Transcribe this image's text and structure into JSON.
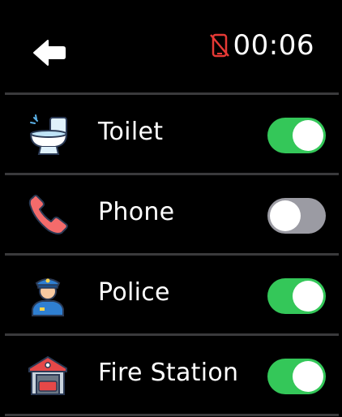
{
  "header": {
    "back_icon": "arrow-left-icon",
    "status_icon": "phone-disabled-icon",
    "time": "00:06"
  },
  "settings": [
    {
      "label": "Toilet",
      "icon": "toilet-icon",
      "enabled": true
    },
    {
      "label": "Phone",
      "icon": "phone-icon",
      "enabled": false
    },
    {
      "label": "Police",
      "icon": "police-officer-icon",
      "enabled": true
    },
    {
      "label": "Fire Station",
      "icon": "fire-station-icon",
      "enabled": true
    }
  ],
  "colors": {
    "background": "#000000",
    "toggle_on": "#34c759",
    "toggle_off": "#9b9ba3",
    "status_icon": "#e53935"
  }
}
